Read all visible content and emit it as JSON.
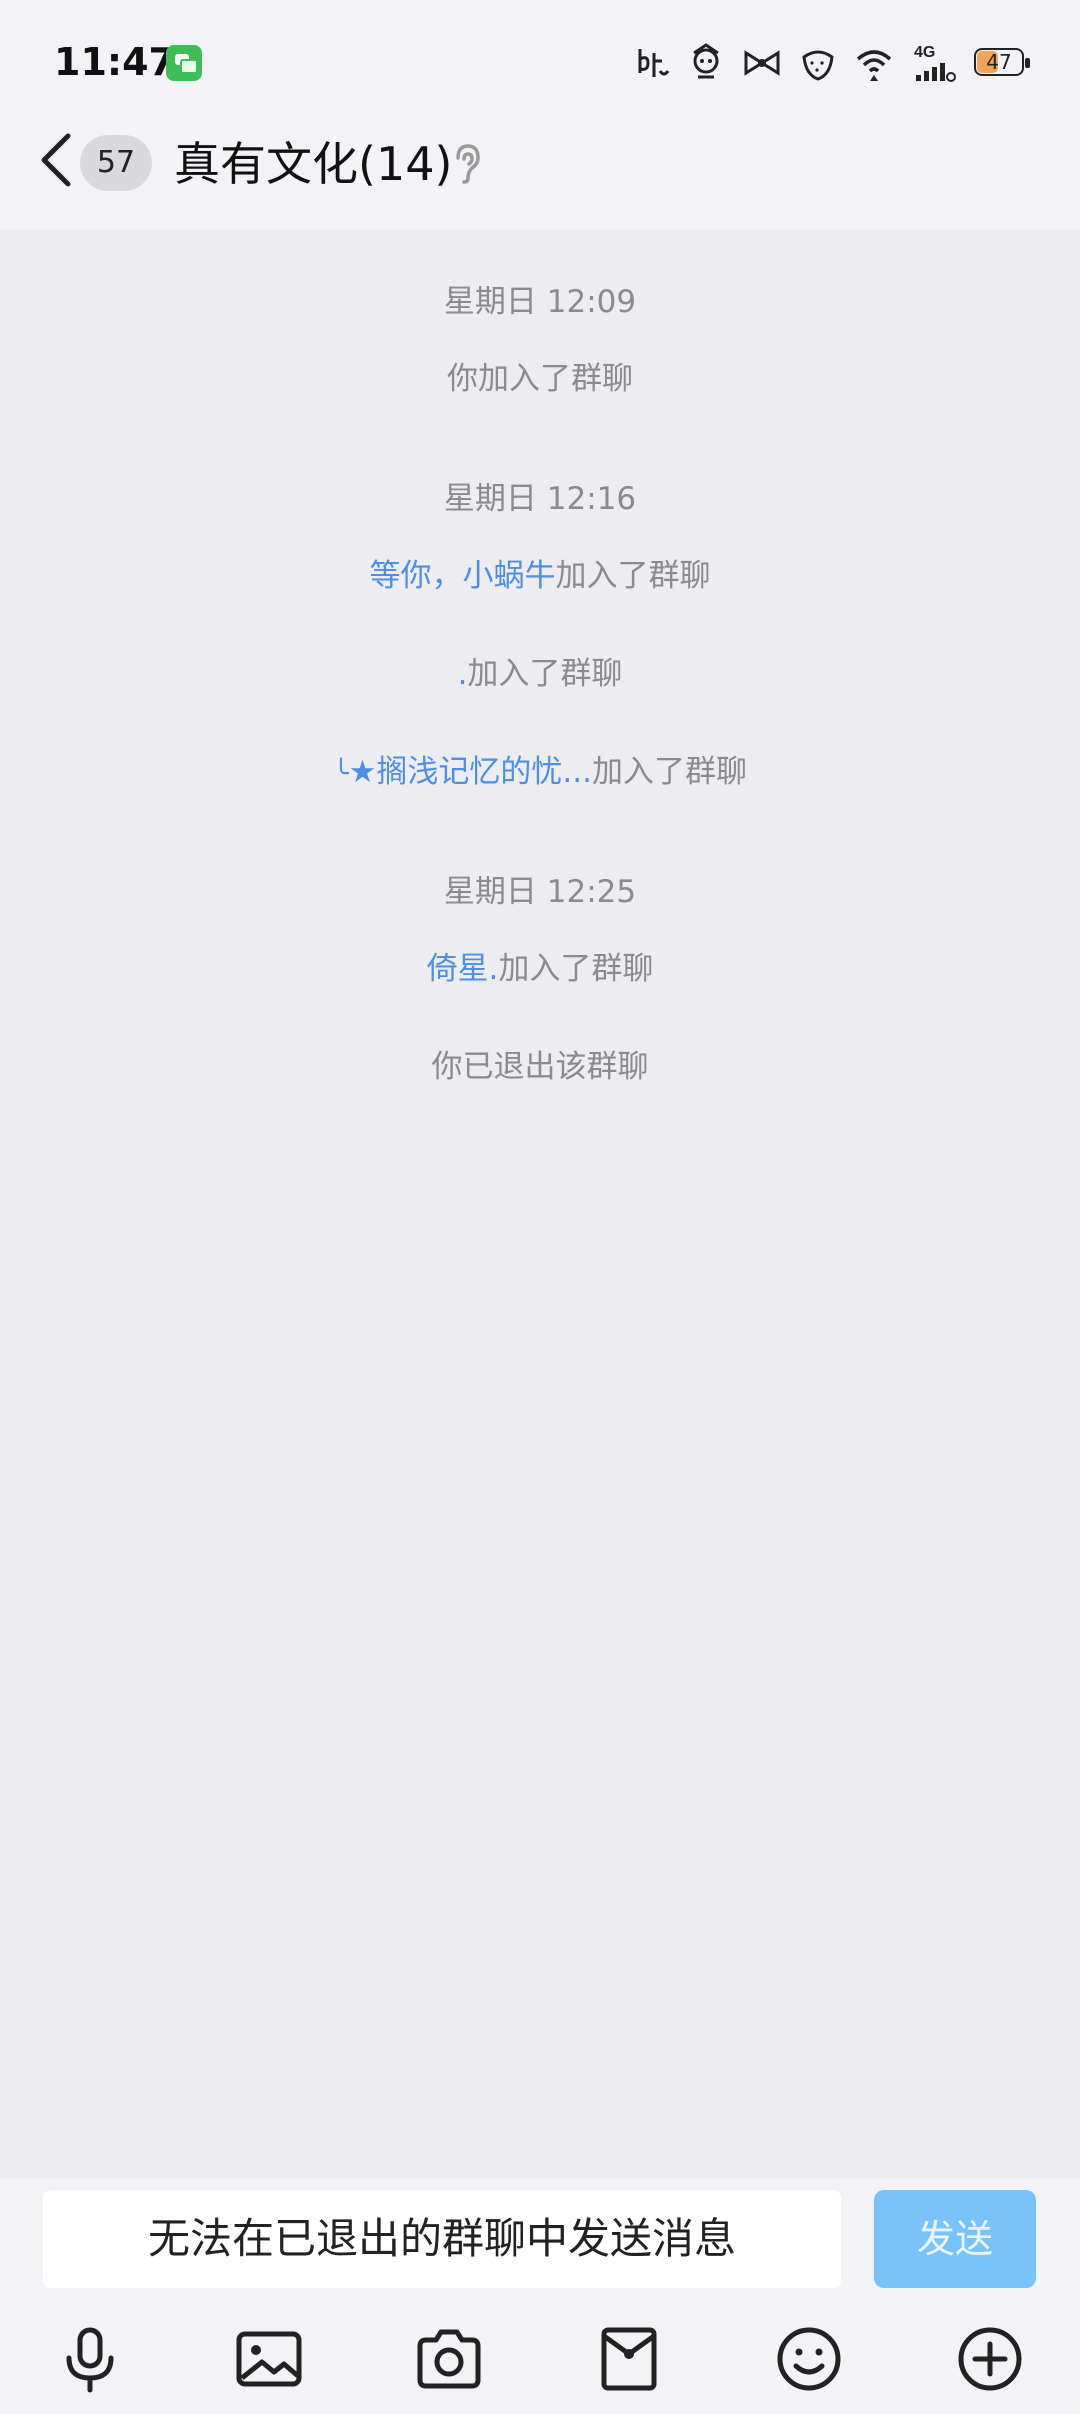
{
  "status_bar": {
    "time": "11:47",
    "battery_level": "47",
    "network_label": "4G"
  },
  "header": {
    "unread_count": "57",
    "title": "真有文化(14)"
  },
  "messages": [
    {
      "type": "timestamp",
      "text": "星期日 12:09"
    },
    {
      "type": "system",
      "text": "你加入了群聊"
    },
    {
      "type": "timestamp",
      "text": "星期日 12:16"
    },
    {
      "type": "join",
      "name": "等你，小蜗牛",
      "action": "加入了群聊"
    },
    {
      "type": "join",
      "name": ".",
      "action": "加入了群聊"
    },
    {
      "type": "join",
      "prefix": "╰",
      "name": "★搁浅记忆的忧...",
      "action": "加入了群聊"
    },
    {
      "type": "timestamp",
      "text": "星期日 12:25"
    },
    {
      "type": "join",
      "name": "倚星.",
      "action": "加入了群聊"
    },
    {
      "type": "system",
      "text": "你已退出该群聊"
    }
  ],
  "input": {
    "disabled_text": "无法在已退出的群聊中发送消息",
    "send_label": "发送"
  },
  "toolbar": {
    "icons": [
      "microphone-icon",
      "image-icon",
      "camera-icon",
      "red-packet-icon",
      "emoji-icon",
      "plus-icon"
    ]
  },
  "colors": {
    "link_name": "#4e8fe0",
    "system_text": "#8a8a90",
    "send_button_bg": "#79c3fa",
    "background": "#edecf1"
  }
}
